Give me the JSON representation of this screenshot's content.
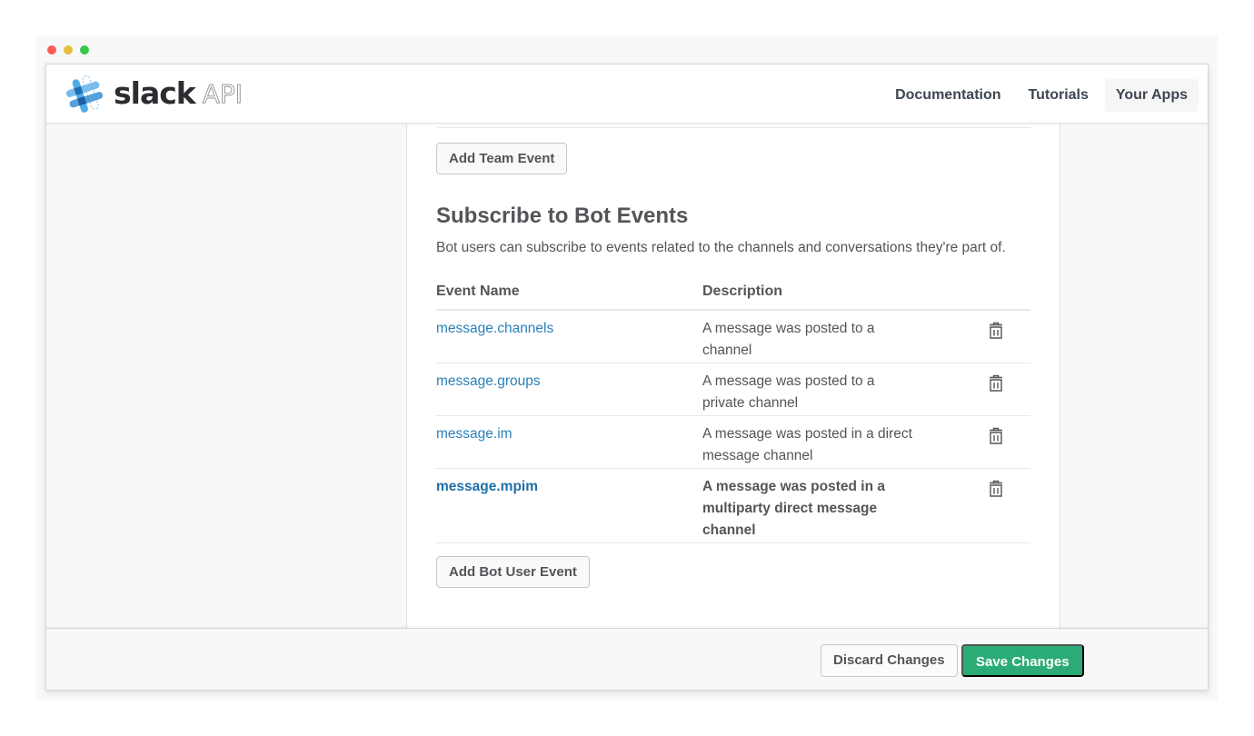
{
  "window": {
    "controls": [
      "close",
      "minimize",
      "maximize"
    ]
  },
  "header": {
    "logo_word": "slack",
    "logo_suffix": "API",
    "nav": [
      {
        "label": "Documentation",
        "active": false
      },
      {
        "label": "Tutorials",
        "active": false
      },
      {
        "label": "Your Apps",
        "active": true
      }
    ]
  },
  "team_events": {
    "add_button": "Add Team Event"
  },
  "bot_events": {
    "title": "Subscribe to Bot Events",
    "description": "Bot users can subscribe to events related to the channels and conversations they're part of.",
    "columns": [
      "Event Name",
      "Description"
    ],
    "rows": [
      {
        "name": "message.channels",
        "description": "A message was posted to a channel",
        "bold": false,
        "action_icon": "trash-icon"
      },
      {
        "name": "message.groups",
        "description": "A message was posted to a private channel",
        "bold": false,
        "action_icon": "trash-icon"
      },
      {
        "name": "message.im",
        "description": "A message was posted in a direct message channel",
        "bold": false,
        "action_icon": "trash-icon"
      },
      {
        "name": "message.mpim",
        "description": "A message was posted in a multiparty direct message channel",
        "bold": true,
        "action_icon": "trash-icon"
      }
    ],
    "add_button": "Add Bot User Event"
  },
  "footer": {
    "discard_label": "Discard Changes",
    "save_label": "Save Changes"
  },
  "colors": {
    "link": "#2a80b9",
    "save_button": "#2bac76",
    "logo_blue": "#3aa3e3"
  }
}
